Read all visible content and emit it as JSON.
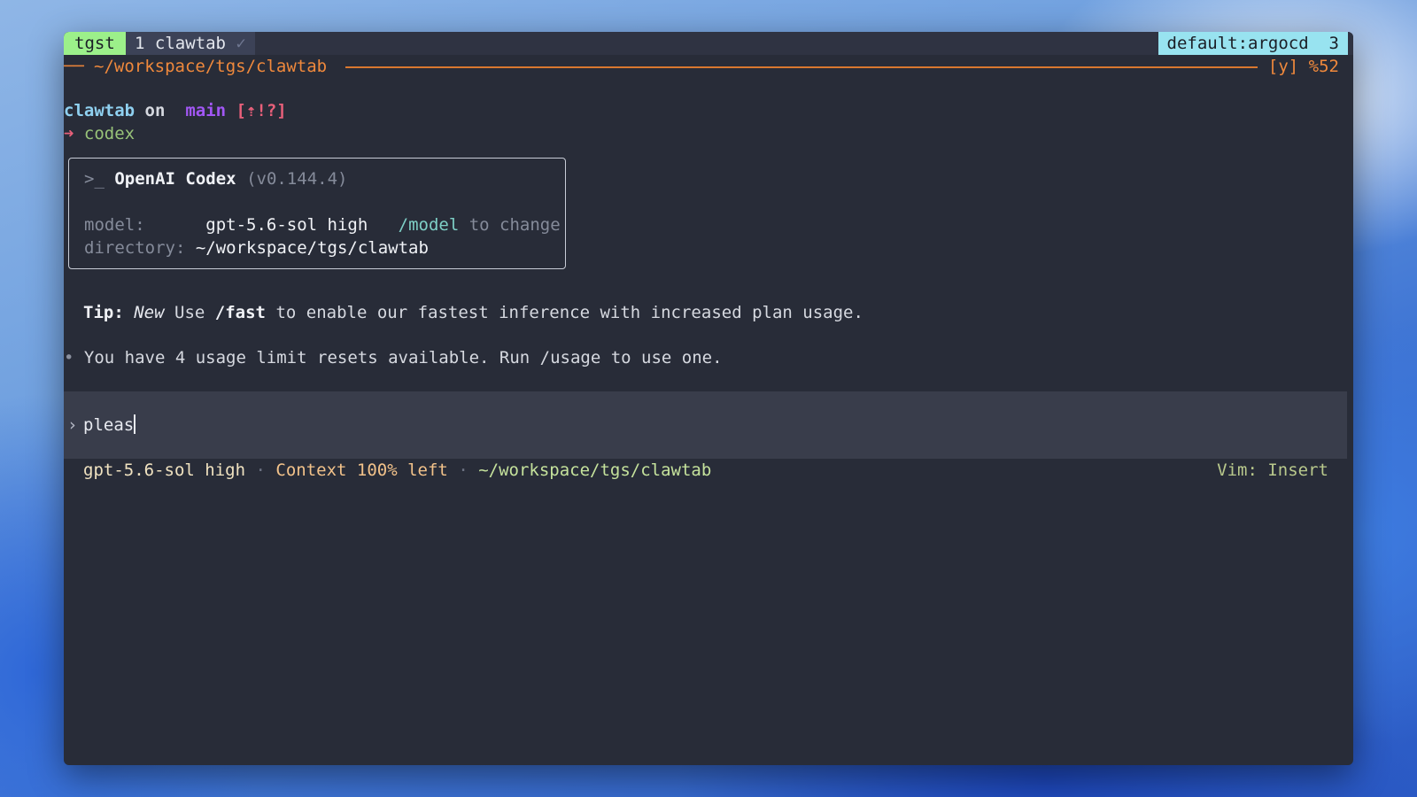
{
  "tmux": {
    "session": "tgst",
    "window": "1 clawtab",
    "window_flag": "✓",
    "context": "default:argocd  3"
  },
  "pane": {
    "dash": "──",
    "path": "~/workspace/tgs/clawtab",
    "right": "[y] %52"
  },
  "shell": {
    "dir": "clawtab",
    "on": "on",
    "branch_icon": "",
    "branch": "main",
    "git_status": "[⇡!?]",
    "arrow": "➜",
    "command": "codex"
  },
  "codex": {
    "prompt_icon": ">_",
    "name": "OpenAI Codex",
    "version": "(v0.144.4)",
    "model_label": "model:",
    "model_value": "gpt-5.6-sol high",
    "model_cmd": "/model",
    "model_hint": "to change",
    "dir_label": "directory:",
    "dir_value": "~/workspace/tgs/clawtab"
  },
  "tip": {
    "label": "Tip:",
    "new": "New",
    "pre": "Use",
    "cmd": "/fast",
    "post": "to enable our fastest inference with increased plan usage."
  },
  "notice": {
    "bullet": "•",
    "text": "You have 4 usage limit resets available. Run /usage to use one."
  },
  "input": {
    "chevron": "›",
    "value": "pleas"
  },
  "status": {
    "model": "gpt-5.6-sol high",
    "sep": "·",
    "context": "Context 100% left",
    "path": "~/workspace/tgs/clawtab",
    "vim": "Vim: Insert"
  },
  "colors": {
    "terminal_bg": "#282c38",
    "session_bg": "#9cf08a",
    "context_badge_bg": "#98e3f0",
    "pane_accent": "#f0893c",
    "branch": "#a257f5"
  }
}
